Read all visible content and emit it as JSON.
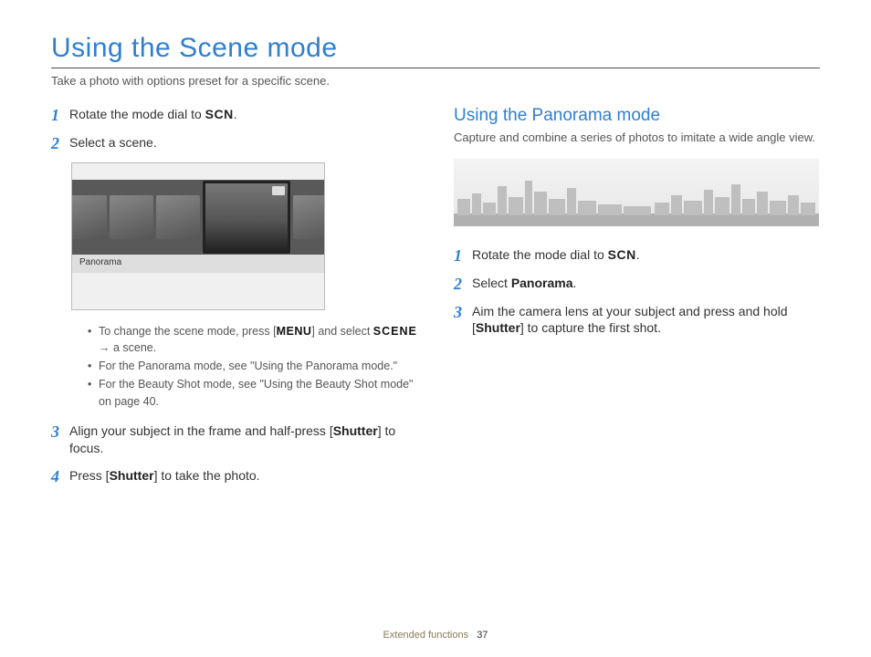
{
  "title": "Using the Scene mode",
  "subtitle": "Take a photo with options preset for a specific scene.",
  "left": {
    "step1": {
      "num": "1",
      "pre": "Rotate the mode dial to ",
      "scn": "SCN",
      "post": "."
    },
    "step2": {
      "num": "2",
      "body": "Select a scene."
    },
    "lcd_label": "Panorama",
    "bullets": {
      "b1_pre": "To change the scene mode, press [",
      "b1_menu": "MENU",
      "b1_mid": "] and select ",
      "b1_scene": "SCENE",
      "b1_post_line": " → a scene.",
      "b2": "For the Panorama mode, see \"Using the Panorama mode.\"",
      "b3": "For the Beauty Shot mode, see \"Using the Beauty Shot mode\" on page 40."
    },
    "step3": {
      "num": "3",
      "pre": "Align your subject in the frame and half-press [",
      "bold": "Shutter",
      "post": "] to focus."
    },
    "step4": {
      "num": "4",
      "pre": "Press [",
      "bold": "Shutter",
      "post": "] to take the photo."
    }
  },
  "right": {
    "heading": "Using the Panorama mode",
    "desc": "Capture and combine a series of photos to imitate a wide angle view.",
    "step1": {
      "num": "1",
      "pre": "Rotate the mode dial to ",
      "scn": "SCN",
      "post": "."
    },
    "step2": {
      "num": "2",
      "pre": "Select ",
      "bold": "Panorama",
      "post": "."
    },
    "step3": {
      "num": "3",
      "pre": "Aim the camera lens at your subject and press and hold [",
      "bold": "Shutter",
      "post": "] to capture the first shot."
    }
  },
  "footer": {
    "section": "Extended functions",
    "page": "37"
  }
}
